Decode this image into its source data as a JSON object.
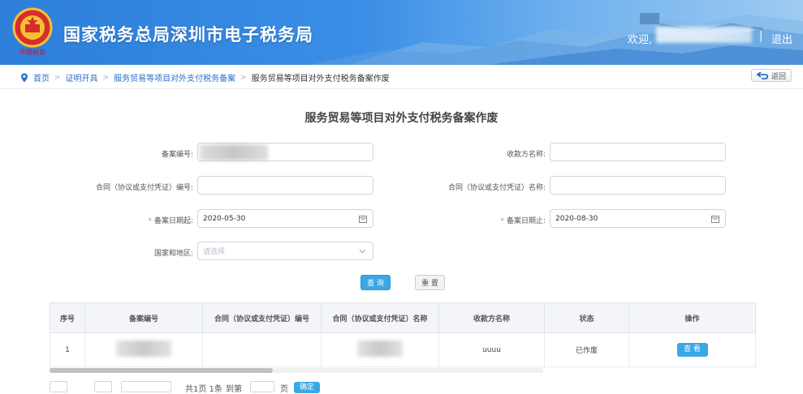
{
  "header": {
    "title": "国家税务总局深圳市电子税务局",
    "welcome": "欢迎,",
    "separator": "|",
    "logout": "退出",
    "colors": {
      "bar": "#2d7fd9",
      "accent": "#3aa7e6"
    }
  },
  "breadcrumb": {
    "items": [
      "首页",
      "证明开具",
      "服务贸易等项目对外支付税务备案"
    ],
    "current": "服务贸易等项目对外支付税务备案作废",
    "back": "返回"
  },
  "form": {
    "title": "服务贸易等项目对外支付税务备案作废",
    "fields": {
      "record_no": {
        "label": "备案编号:",
        "value": ""
      },
      "payee_name": {
        "label": "收款方名称:",
        "value": ""
      },
      "contract_no": {
        "label": "合同（协议或支付凭证）编号:",
        "value": ""
      },
      "contract_name": {
        "label": "合同（协议或支付凭证）名称:",
        "value": ""
      },
      "date_from": {
        "label": "备案日期起:",
        "value": "2020-05-30"
      },
      "date_to": {
        "label": "备案日期止:",
        "value": "2020-08-30"
      },
      "country": {
        "label": "国家和地区:",
        "placeholder": "请选择"
      }
    },
    "required_mark": "*",
    "query_button": "查 询",
    "reset_button": "重 置"
  },
  "table": {
    "columns": [
      "序号",
      "备案编号",
      "合同（协议或支付凭证）编号",
      "合同（协议或支付凭证）名称",
      "收款方名称",
      "状态",
      "操作"
    ],
    "rows": [
      {
        "index": "1",
        "record_no": "",
        "contract_no": "",
        "contract_name": "",
        "payee": "uuuu",
        "status": "已作废",
        "action": "查 看"
      }
    ]
  },
  "pager": {
    "total_text": "共1页 1条",
    "goto_text": "到第",
    "page_unit": "页",
    "go_button": "确定"
  }
}
